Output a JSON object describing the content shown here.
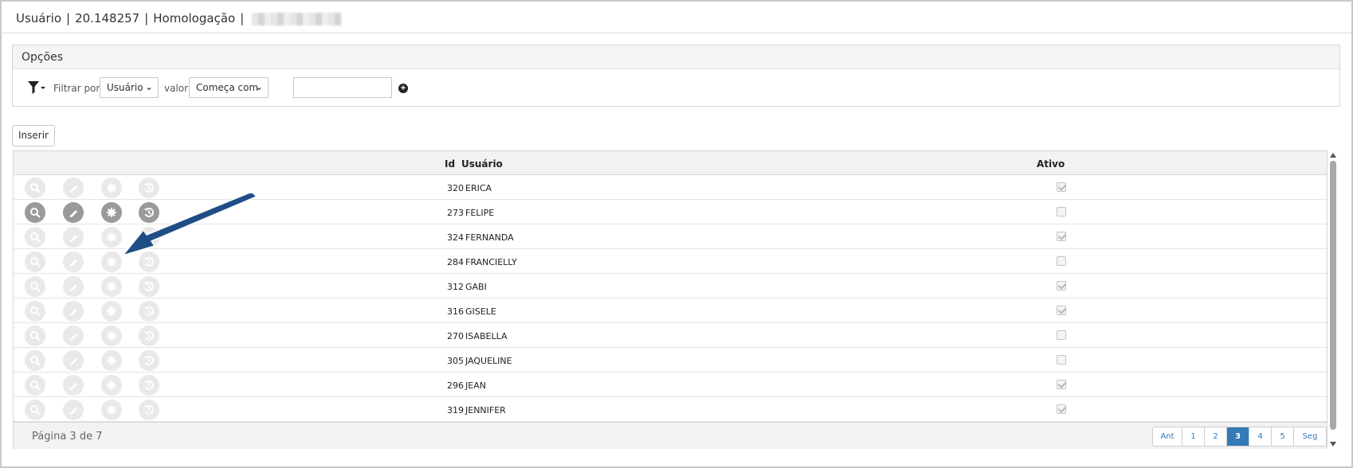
{
  "header": {
    "title_user": "Usuário",
    "title_code": "20.148257",
    "title_env": "Homologação",
    "separator": "|"
  },
  "options": {
    "title": "Opções",
    "filter_by_label": "Filtrar por",
    "filter_field_selected": "Usuário",
    "value_label": "valor",
    "operator_selected": "Começa com",
    "value_input": ""
  },
  "toolbar": {
    "insert_label": "Inserir"
  },
  "grid": {
    "columns": {
      "id": "Id",
      "user": "Usuário",
      "active": "Ativo"
    },
    "rows": [
      {
        "id": "320",
        "user": "ERICA",
        "active": true
      },
      {
        "id": "273",
        "user": "FELIPE",
        "active": false
      },
      {
        "id": "324",
        "user": "FERNANDA",
        "active": true
      },
      {
        "id": "284",
        "user": "FRANCIELLY",
        "active": false
      },
      {
        "id": "312",
        "user": "GABI",
        "active": true
      },
      {
        "id": "316",
        "user": "GISELE",
        "active": true
      },
      {
        "id": "270",
        "user": "ISABELLA",
        "active": false
      },
      {
        "id": "305",
        "user": "JAQUELINE",
        "active": false
      },
      {
        "id": "296",
        "user": "JEAN",
        "active": true
      },
      {
        "id": "319",
        "user": "JENNIFER",
        "active": true
      }
    ],
    "row_actions": [
      "search-icon",
      "edit-icon",
      "gear-icon",
      "history-icon"
    ],
    "highlighted_row": 1
  },
  "pagination": {
    "info": "Página 3 de 7",
    "prev": "Ant",
    "pages": [
      "1",
      "2",
      "3",
      "4",
      "5"
    ],
    "current": "3",
    "next": "Seg"
  },
  "colors": {
    "accent": "#337ab7",
    "annotation_arrow": "#1f4e86"
  }
}
